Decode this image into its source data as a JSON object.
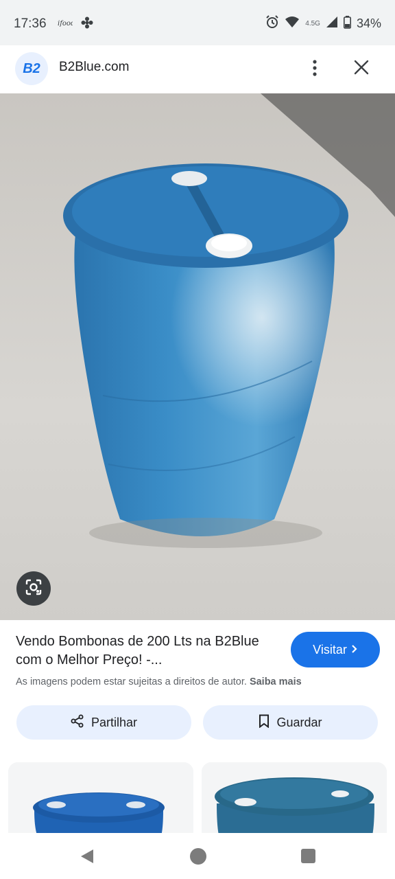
{
  "status_bar": {
    "time": "17:36",
    "network": "4.5G",
    "battery": "34%",
    "icons": [
      "notification-icon",
      "flower-icon",
      "alarm-icon",
      "wifi-icon",
      "signal-icon",
      "battery-icon"
    ]
  },
  "header": {
    "logo_text": "B2",
    "site_name": "B2Blue.com",
    "icons": [
      "more-vert-icon",
      "close-icon"
    ]
  },
  "image": {
    "subject": "blue plastic drum",
    "lens_icon": "lens-icon"
  },
  "result": {
    "title": "Vendo Bombonas de 200 Lts na B2Blue com o Melhor Preço! -...",
    "visit_label": "Visitar",
    "copyright_text": "As imagens podem estar sujeitas a direitos de autor.",
    "learn_more": "Saiba mais"
  },
  "actions": {
    "share_label": "Partilhar",
    "save_label": "Guardar"
  },
  "colors": {
    "accent": "#1a73e8",
    "chip_bg": "#e8f0fe",
    "drum_blue": "#2e7fbf"
  }
}
